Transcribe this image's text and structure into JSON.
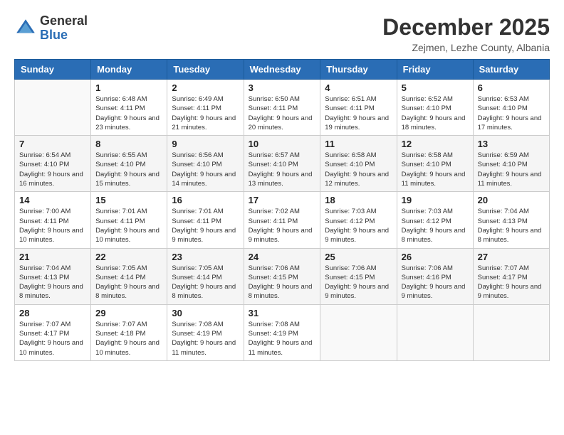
{
  "header": {
    "logo": {
      "general": "General",
      "blue": "Blue"
    },
    "title": "December 2025",
    "location": "Zejmen, Lezhe County, Albania"
  },
  "weekdays": [
    "Sunday",
    "Monday",
    "Tuesday",
    "Wednesday",
    "Thursday",
    "Friday",
    "Saturday"
  ],
  "weeks": [
    [
      {
        "day": "",
        "sunrise": "",
        "sunset": "",
        "daylight": ""
      },
      {
        "day": "1",
        "sunrise": "Sunrise: 6:48 AM",
        "sunset": "Sunset: 4:11 PM",
        "daylight": "Daylight: 9 hours and 23 minutes."
      },
      {
        "day": "2",
        "sunrise": "Sunrise: 6:49 AM",
        "sunset": "Sunset: 4:11 PM",
        "daylight": "Daylight: 9 hours and 21 minutes."
      },
      {
        "day": "3",
        "sunrise": "Sunrise: 6:50 AM",
        "sunset": "Sunset: 4:11 PM",
        "daylight": "Daylight: 9 hours and 20 minutes."
      },
      {
        "day": "4",
        "sunrise": "Sunrise: 6:51 AM",
        "sunset": "Sunset: 4:11 PM",
        "daylight": "Daylight: 9 hours and 19 minutes."
      },
      {
        "day": "5",
        "sunrise": "Sunrise: 6:52 AM",
        "sunset": "Sunset: 4:10 PM",
        "daylight": "Daylight: 9 hours and 18 minutes."
      },
      {
        "day": "6",
        "sunrise": "Sunrise: 6:53 AM",
        "sunset": "Sunset: 4:10 PM",
        "daylight": "Daylight: 9 hours and 17 minutes."
      }
    ],
    [
      {
        "day": "7",
        "sunrise": "Sunrise: 6:54 AM",
        "sunset": "Sunset: 4:10 PM",
        "daylight": "Daylight: 9 hours and 16 minutes."
      },
      {
        "day": "8",
        "sunrise": "Sunrise: 6:55 AM",
        "sunset": "Sunset: 4:10 PM",
        "daylight": "Daylight: 9 hours and 15 minutes."
      },
      {
        "day": "9",
        "sunrise": "Sunrise: 6:56 AM",
        "sunset": "Sunset: 4:10 PM",
        "daylight": "Daylight: 9 hours and 14 minutes."
      },
      {
        "day": "10",
        "sunrise": "Sunrise: 6:57 AM",
        "sunset": "Sunset: 4:10 PM",
        "daylight": "Daylight: 9 hours and 13 minutes."
      },
      {
        "day": "11",
        "sunrise": "Sunrise: 6:58 AM",
        "sunset": "Sunset: 4:10 PM",
        "daylight": "Daylight: 9 hours and 12 minutes."
      },
      {
        "day": "12",
        "sunrise": "Sunrise: 6:58 AM",
        "sunset": "Sunset: 4:10 PM",
        "daylight": "Daylight: 9 hours and 11 minutes."
      },
      {
        "day": "13",
        "sunrise": "Sunrise: 6:59 AM",
        "sunset": "Sunset: 4:10 PM",
        "daylight": "Daylight: 9 hours and 11 minutes."
      }
    ],
    [
      {
        "day": "14",
        "sunrise": "Sunrise: 7:00 AM",
        "sunset": "Sunset: 4:11 PM",
        "daylight": "Daylight: 9 hours and 10 minutes."
      },
      {
        "day": "15",
        "sunrise": "Sunrise: 7:01 AM",
        "sunset": "Sunset: 4:11 PM",
        "daylight": "Daylight: 9 hours and 10 minutes."
      },
      {
        "day": "16",
        "sunrise": "Sunrise: 7:01 AM",
        "sunset": "Sunset: 4:11 PM",
        "daylight": "Daylight: 9 hours and 9 minutes."
      },
      {
        "day": "17",
        "sunrise": "Sunrise: 7:02 AM",
        "sunset": "Sunset: 4:11 PM",
        "daylight": "Daylight: 9 hours and 9 minutes."
      },
      {
        "day": "18",
        "sunrise": "Sunrise: 7:03 AM",
        "sunset": "Sunset: 4:12 PM",
        "daylight": "Daylight: 9 hours and 9 minutes."
      },
      {
        "day": "19",
        "sunrise": "Sunrise: 7:03 AM",
        "sunset": "Sunset: 4:12 PM",
        "daylight": "Daylight: 9 hours and 8 minutes."
      },
      {
        "day": "20",
        "sunrise": "Sunrise: 7:04 AM",
        "sunset": "Sunset: 4:13 PM",
        "daylight": "Daylight: 9 hours and 8 minutes."
      }
    ],
    [
      {
        "day": "21",
        "sunrise": "Sunrise: 7:04 AM",
        "sunset": "Sunset: 4:13 PM",
        "daylight": "Daylight: 9 hours and 8 minutes."
      },
      {
        "day": "22",
        "sunrise": "Sunrise: 7:05 AM",
        "sunset": "Sunset: 4:14 PM",
        "daylight": "Daylight: 9 hours and 8 minutes."
      },
      {
        "day": "23",
        "sunrise": "Sunrise: 7:05 AM",
        "sunset": "Sunset: 4:14 PM",
        "daylight": "Daylight: 9 hours and 8 minutes."
      },
      {
        "day": "24",
        "sunrise": "Sunrise: 7:06 AM",
        "sunset": "Sunset: 4:15 PM",
        "daylight": "Daylight: 9 hours and 8 minutes."
      },
      {
        "day": "25",
        "sunrise": "Sunrise: 7:06 AM",
        "sunset": "Sunset: 4:15 PM",
        "daylight": "Daylight: 9 hours and 9 minutes."
      },
      {
        "day": "26",
        "sunrise": "Sunrise: 7:06 AM",
        "sunset": "Sunset: 4:16 PM",
        "daylight": "Daylight: 9 hours and 9 minutes."
      },
      {
        "day": "27",
        "sunrise": "Sunrise: 7:07 AM",
        "sunset": "Sunset: 4:17 PM",
        "daylight": "Daylight: 9 hours and 9 minutes."
      }
    ],
    [
      {
        "day": "28",
        "sunrise": "Sunrise: 7:07 AM",
        "sunset": "Sunset: 4:17 PM",
        "daylight": "Daylight: 9 hours and 10 minutes."
      },
      {
        "day": "29",
        "sunrise": "Sunrise: 7:07 AM",
        "sunset": "Sunset: 4:18 PM",
        "daylight": "Daylight: 9 hours and 10 minutes."
      },
      {
        "day": "30",
        "sunrise": "Sunrise: 7:08 AM",
        "sunset": "Sunset: 4:19 PM",
        "daylight": "Daylight: 9 hours and 11 minutes."
      },
      {
        "day": "31",
        "sunrise": "Sunrise: 7:08 AM",
        "sunset": "Sunset: 4:19 PM",
        "daylight": "Daylight: 9 hours and 11 minutes."
      },
      {
        "day": "",
        "sunrise": "",
        "sunset": "",
        "daylight": ""
      },
      {
        "day": "",
        "sunrise": "",
        "sunset": "",
        "daylight": ""
      },
      {
        "day": "",
        "sunrise": "",
        "sunset": "",
        "daylight": ""
      }
    ]
  ]
}
